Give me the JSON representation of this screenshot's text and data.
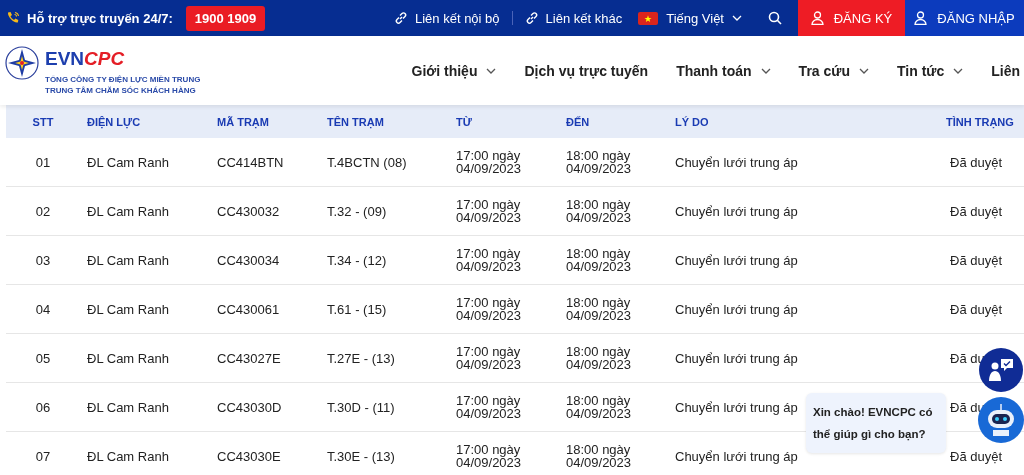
{
  "top_bar": {
    "hotline_label": "Hỗ trợ trực truyến 24/7:",
    "hotline_number": "1900 1909",
    "links": [
      "Liên kết nội bộ",
      "Liên kết khác"
    ],
    "language": "Tiếng Việt",
    "register": "ĐĂNG KÝ",
    "login": "ĐĂNG NHẬP"
  },
  "header": {
    "logo_brand": "EVN",
    "logo_brand_accent": "CPC",
    "logo_line_1": "TỔNG CÔNG TY ĐIỆN LỰC MIỀN TRUNG",
    "logo_line_2": "TRUNG TÂM CHĂM SÓC KHÁCH HÀNG",
    "nav": [
      {
        "label": "Giới thiệu",
        "expandable": true
      },
      {
        "label": "Dịch vụ trực tuyến",
        "expandable": false
      },
      {
        "label": "Thanh toán",
        "expandable": true
      },
      {
        "label": "Tra cứu",
        "expandable": true
      },
      {
        "label": "Tin tức",
        "expandable": true
      },
      {
        "label": "Liên",
        "expandable": false
      }
    ]
  },
  "table": {
    "columns": [
      "STT",
      "ĐIỆN LỰC",
      "MÃ TRẠM",
      "TÊN TRẠM",
      "TỪ",
      "ĐẾN",
      "LÝ DO",
      "TÌNH TRẠNG"
    ],
    "rows": [
      [
        "01",
        "ĐL Cam Ranh",
        "CC414BTN",
        "T.4BCTN (08)",
        "17:00 ngày 04/09/2023",
        "18:00 ngày 04/09/2023",
        "Chuyển lưới trung áp",
        "Đã duyệt"
      ],
      [
        "02",
        "ĐL Cam Ranh",
        "CC430032",
        "T.32 - (09)",
        "17:00 ngày 04/09/2023",
        "18:00 ngày 04/09/2023",
        "Chuyển lưới trung áp",
        "Đã duyệt"
      ],
      [
        "03",
        "ĐL Cam Ranh",
        "CC430034",
        "T.34 - (12)",
        "17:00 ngày 04/09/2023",
        "18:00 ngày 04/09/2023",
        "Chuyển lưới trung áp",
        "Đã duyệt"
      ],
      [
        "04",
        "ĐL Cam Ranh",
        "CC430061",
        "T.61 - (15)",
        "17:00 ngày 04/09/2023",
        "18:00 ngày 04/09/2023",
        "Chuyển lưới trung áp",
        "Đã duyệt"
      ],
      [
        "05",
        "ĐL Cam Ranh",
        "CC43027E",
        "T.27E - (13)",
        "17:00 ngày 04/09/2023",
        "18:00 ngày 04/09/2023",
        "Chuyển lưới trung áp",
        "Đã du"
      ],
      [
        "06",
        "ĐL Cam Ranh",
        "CC43030D",
        "T.30D - (11)",
        "17:00 ngày 04/09/2023",
        "18:00 ngày 04/09/2023",
        "Chuyển lưới trung áp",
        "Đã du"
      ],
      [
        "07",
        "ĐL Cam Ranh",
        "CC43030E",
        "T.30E - (13)",
        "17:00 ngày 04/09/2023",
        "18:00 ngày 04/09/2023",
        "Chuyển lưới trung áp",
        "Đã duyệt"
      ]
    ]
  },
  "chat": {
    "greeting": "Xin chào! EVNCPC có thể giúp gì cho bạn?"
  }
}
